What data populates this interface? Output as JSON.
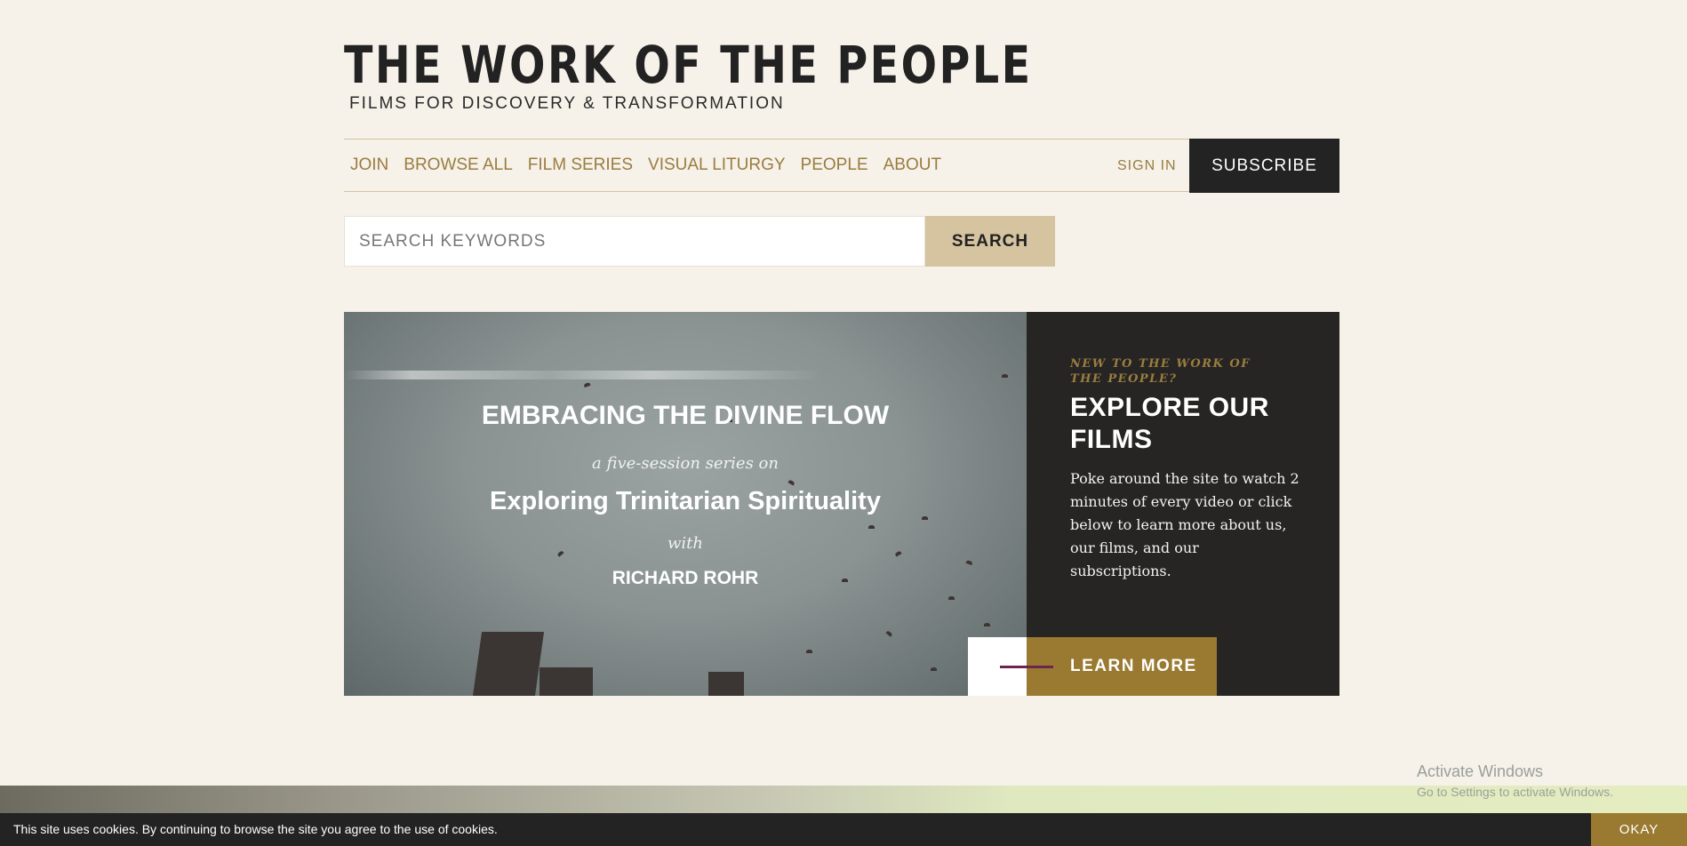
{
  "header": {
    "logo_title": "THE WORK OF THE PEOPLE",
    "tagline": "FILMS FOR DISCOVERY & TRANSFORMATION"
  },
  "nav": {
    "items": [
      {
        "label": "JOIN"
      },
      {
        "label": "BROWSE ALL"
      },
      {
        "label": "FILM SERIES"
      },
      {
        "label": "VISUAL LITURGY"
      },
      {
        "label": "PEOPLE"
      },
      {
        "label": "ABOUT"
      }
    ],
    "sign_in": "SIGN IN",
    "subscribe": "SUBSCRIBE"
  },
  "search": {
    "placeholder": "SEARCH KEYWORDS",
    "value": "",
    "button": "SEARCH"
  },
  "hero": {
    "title": "EMBRACING THE DIVINE FLOW",
    "subtitle": "a five-session series on",
    "main": "Exploring Trinitarian Spirituality",
    "with": "with",
    "name": "RICHARD ROHR"
  },
  "side": {
    "kicker": "NEW TO THE WORK OF THE PEOPLE?",
    "title": "EXPLORE OUR FILMS",
    "body": "Poke around the site to watch 2 minutes of every video or click below to learn more about us, our films, and our subscriptions.",
    "button": "LEARN MORE"
  },
  "watermark": {
    "line1": "Activate Windows",
    "line2": "Go to Settings to activate Windows."
  },
  "cookie": {
    "text": "This site uses cookies. By continuing to browse the site you agree to the use of cookies.",
    "button": "OKAY"
  },
  "colors": {
    "background": "#f6f1e9",
    "gold": "#9a7d3f",
    "dark": "#232323",
    "tan": "#d6c3a0"
  }
}
